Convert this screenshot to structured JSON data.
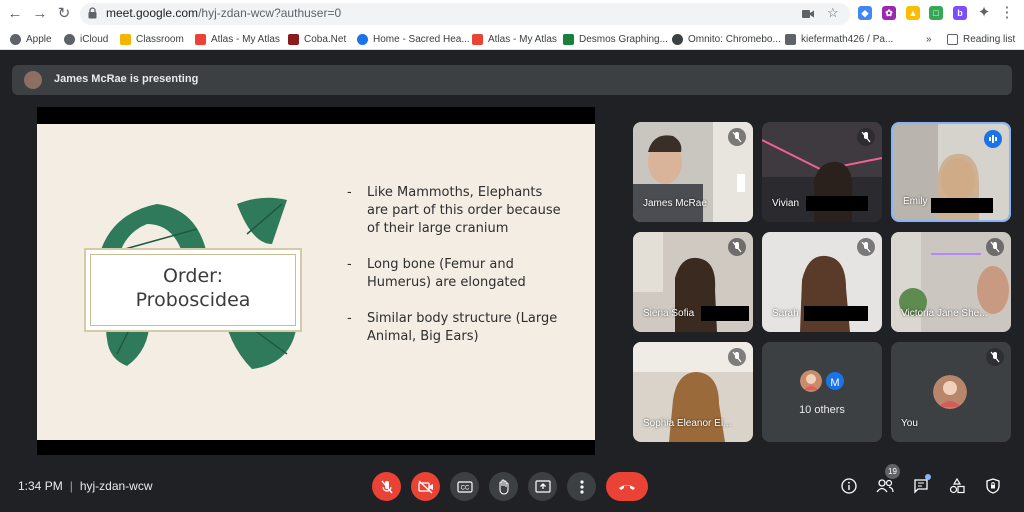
{
  "browser": {
    "url_host": "meet.google.com",
    "url_path": "/hyj-zdan-wcw?authuser=0",
    "bookmarks": [
      {
        "label": "Apple",
        "color": "#5f6368"
      },
      {
        "label": "iCloud",
        "color": "#5f6368"
      },
      {
        "label": "Classroom",
        "color": "#f4b400"
      },
      {
        "label": "Atlas - My Atlas",
        "color": "#ea4335"
      },
      {
        "label": "Coba.Net",
        "color": "#8b1a1a"
      },
      {
        "label": "Home - Sacred Hea...",
        "color": "#1a73e8"
      },
      {
        "label": "Atlas - My Atlas",
        "color": "#ea4335"
      },
      {
        "label": "Desmos Graphing...",
        "color": "#188038"
      },
      {
        "label": "Omnito: Chromebo...",
        "color": "#3c4043"
      },
      {
        "label": "kiefermath426 / Pa...",
        "color": "#5f6368"
      }
    ],
    "more_bookmarks": "»",
    "reading_list": "Reading list"
  },
  "meet": {
    "presenting_text": "James McRae is presenting",
    "slide": {
      "title_line1": "Order:",
      "title_line2": "Proboscidea",
      "bullets": [
        "Like Mammoths, Elephants are part of this order because of their large cranium",
        "Long bone (Femur and Humerus) are elongated",
        "Similar body structure (Large Animal, Big Ears)"
      ],
      "dash": "-"
    },
    "participants": [
      {
        "name": "James McRae"
      },
      {
        "name": "Vivian"
      },
      {
        "name": "Emily"
      },
      {
        "name": "Siena Sofia"
      },
      {
        "name": "Sarah"
      },
      {
        "name": "Victoria Jane She..."
      },
      {
        "name": "Sophia Eleanor El..."
      },
      {
        "name": "10 others"
      },
      {
        "name": "You"
      }
    ],
    "others_avatar_letter": "M",
    "time": "1:34 PM",
    "separator": "|",
    "meeting_code": "hyj-zdan-wcw",
    "people_count": "19"
  }
}
